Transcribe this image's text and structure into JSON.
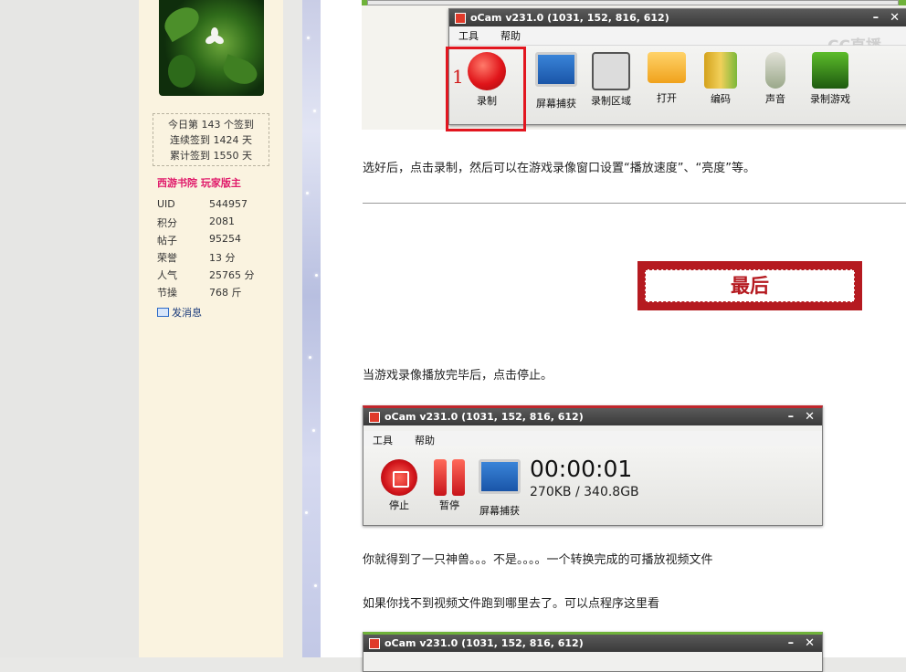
{
  "sidebar": {
    "sign_lines": [
      "今日第 143 个签到",
      "连续签到 1424 天",
      "累计签到 1550 天"
    ],
    "username": "西游书院 玩家版主",
    "stats": [
      {
        "label": "UID",
        "value": "544957"
      },
      {
        "label": "积分",
        "value": "2081"
      },
      {
        "label": "帖子",
        "value": "95254"
      },
      {
        "label": "荣誉",
        "value": "13 分"
      },
      {
        "label": "人气",
        "value": "25765 分"
      },
      {
        "label": "节操",
        "value": "768 斤"
      }
    ],
    "message_link": "发消息"
  },
  "ocam1": {
    "title": "oCam v231.0 (1031, 152, 816, 612)",
    "menu": [
      "工具",
      "帮助"
    ],
    "brand": "CC直播",
    "highlight_number": "1",
    "tools": [
      "录制",
      "屏幕捕获",
      "录制区域",
      "打开",
      "编码",
      "声音",
      "录制游戏"
    ]
  },
  "text": {
    "p1": "选好后，点击录制，然后可以在游戏录像窗口设置“播放速度”、“亮度”等。",
    "banner": "最后",
    "p2": "当游戏录像播放完毕后，点击停止。",
    "p3": "你就得到了一只神兽。。。不是。。。。一个转换完成的可播放视频文件",
    "p4": "如果你找不到视频文件跑到哪里去了。可以点程序这里看"
  },
  "ocam2": {
    "title": "oCam v231.0 (1031, 152, 816, 612)",
    "menu": [
      "工具",
      "帮助"
    ],
    "buttons": [
      "停止",
      "暂停",
      "屏幕捕获"
    ],
    "timer": "00:00:01",
    "size": "270KB / 340.8GB"
  },
  "ocam3": {
    "title": "oCam v231.0 (1031, 152, 816, 612)"
  },
  "colors": {
    "accent_red": "#e2161f",
    "banner_red": "#b51a20",
    "username_pink": "#e01a6a",
    "green_frame": "#6fb23a"
  },
  "icons": [
    "mail-icon",
    "record-icon",
    "monitor-icon",
    "region-icon",
    "folder-icon",
    "encode-icon",
    "microphone-icon",
    "game-icon",
    "stop-icon",
    "pause-icon",
    "minimize-icon",
    "close-icon"
  ]
}
